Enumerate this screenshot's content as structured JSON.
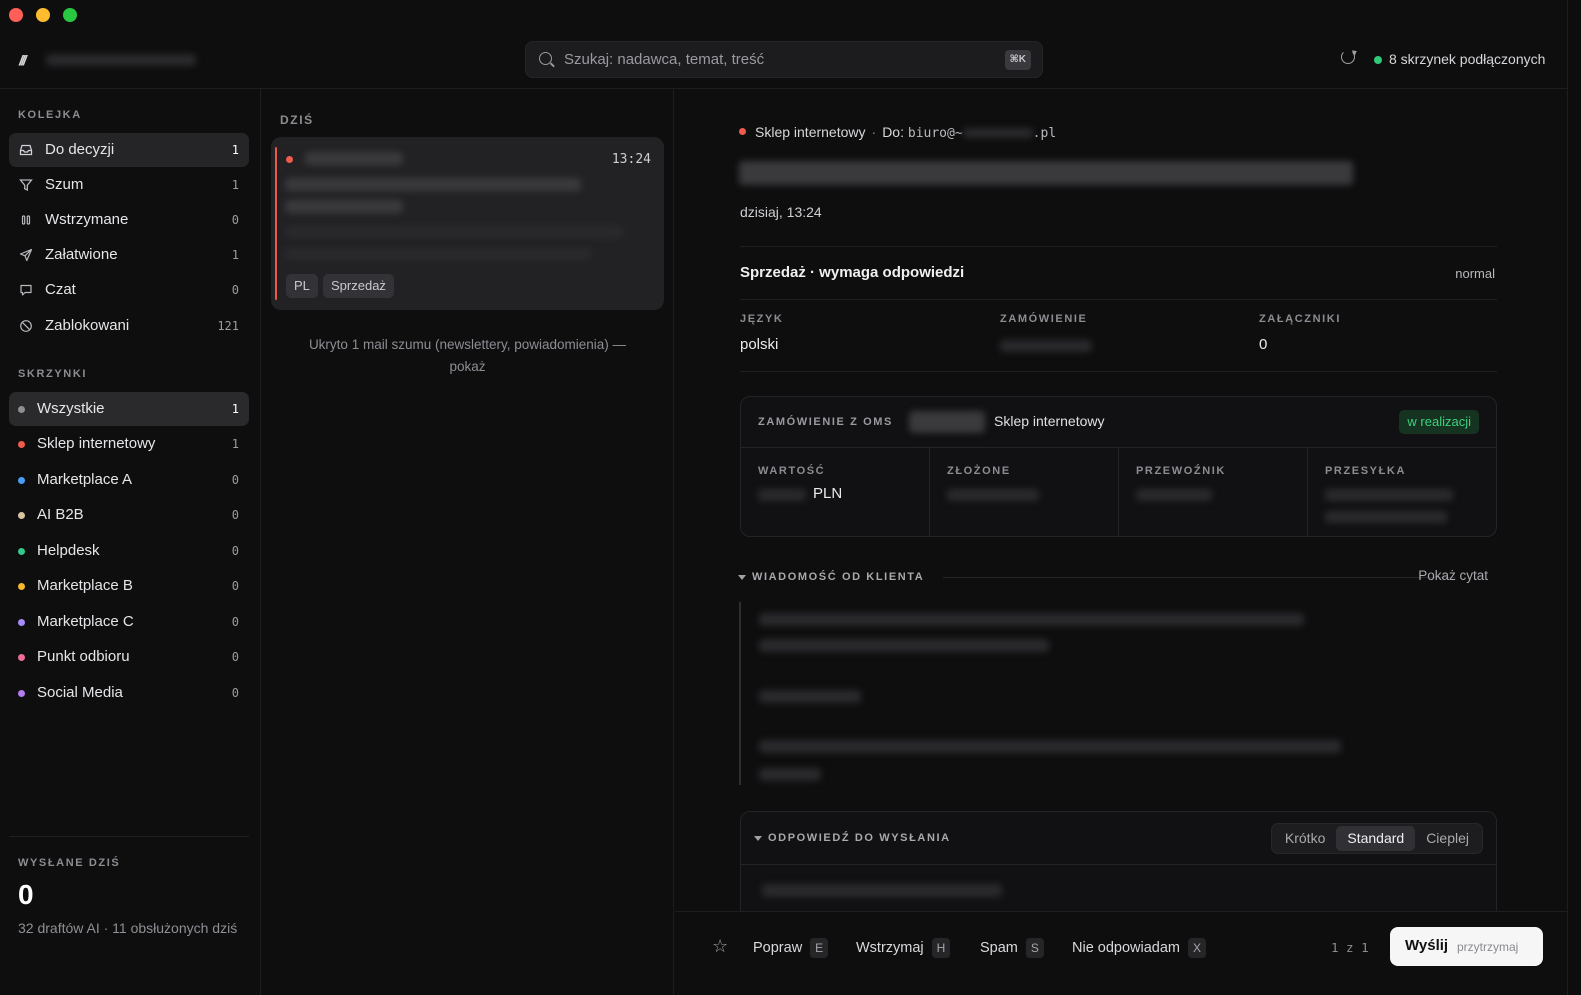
{
  "topbar": {
    "logo": "///",
    "search_placeholder": "Szukaj: nadawca, temat, treść",
    "search_shortcut": "⌘K",
    "status": "8 skrzynek podłączonych",
    "status_color": "#30c97a"
  },
  "sidebar": {
    "queue_label": "KOLEJKA",
    "queue": [
      {
        "label": "Do decyzji",
        "count": "1",
        "icon": "inbox-icon"
      },
      {
        "label": "Szum",
        "count": "1",
        "icon": "filter-icon"
      },
      {
        "label": "Wstrzymane",
        "count": "0",
        "icon": "pause-icon"
      },
      {
        "label": "Załatwione",
        "count": "1",
        "icon": "send-icon"
      },
      {
        "label": "Czat",
        "count": "0",
        "icon": "chat-icon"
      },
      {
        "label": "Zablokowani",
        "count": "121",
        "icon": "block-icon"
      }
    ],
    "boxes_label": "SKRZYNKI",
    "boxes": [
      {
        "label": "Wszystkie",
        "count": "1",
        "color": "#8e8e93"
      },
      {
        "label": "Sklep internetowy",
        "count": "1",
        "color": "#ef5c4b"
      },
      {
        "label": "Marketplace A",
        "count": "0",
        "color": "#4a9df5"
      },
      {
        "label": "AI B2B",
        "count": "0",
        "color": "#d6c3a0"
      },
      {
        "label": "Helpdesk",
        "count": "0",
        "color": "#34c98b"
      },
      {
        "label": "Marketplace B",
        "count": "0",
        "color": "#f5b731"
      },
      {
        "label": "Marketplace C",
        "count": "0",
        "color": "#a78bfa"
      },
      {
        "label": "Punkt odbioru",
        "count": "0",
        "color": "#f06c9b"
      },
      {
        "label": "Social Media",
        "count": "0",
        "color": "#b57cf2"
      }
    ],
    "sent_label": "WYSŁANE DZIŚ",
    "sent_count": "0",
    "sent_desc": "32 draftów AI · 11 obsłużonych dziś"
  },
  "list": {
    "section": "DZIŚ",
    "mail": {
      "time": "13:24",
      "tags": [
        "PL",
        "Sprzedaż"
      ]
    },
    "hidden_note": "Ukryto 1 mail szumu (newslettery, powiadomienia) — pokaż"
  },
  "detail": {
    "from": "Sklep internetowy",
    "to_label": "Do:",
    "to_prefix": "biuro@~",
    "to_suffix": ".pl",
    "date": "dzisiaj, 13:24",
    "category": "Sprzedaż · wymaga odpowiedzi",
    "priority": "normal",
    "meta": {
      "lang_label": "JĘZYK",
      "lang_value": "polski",
      "order_label": "ZAMÓWIENIE",
      "attach_label": "ZAŁĄCZNIKI",
      "attach_value": "0"
    },
    "oms": {
      "label": "ZAMÓWIENIE Z OMS",
      "shop": "Sklep internetowy",
      "status": "w realizacji",
      "value_label": "WARTOŚĆ",
      "currency": "PLN",
      "placed_label": "ZŁOŻONE",
      "carrier_label": "PRZEWOŹNIK",
      "shipment_label": "PRZESYŁKA"
    },
    "message_label": "WIADOMOŚĆ OD KLIENTA",
    "show_quote": "Pokaż cytat",
    "reply_label": "ODPOWIEDŹ DO WYSŁANIA",
    "tones": [
      "Krótko",
      "Standard",
      "Cieplej"
    ],
    "tone_active": "Standard"
  },
  "actions": {
    "fix": "Popraw",
    "fix_key": "E",
    "hold": "Wstrzymaj",
    "hold_key": "H",
    "spam": "Spam",
    "spam_key": "S",
    "noreply": "Nie odpowiadam",
    "noreply_key": "X",
    "pager": "1 z 1",
    "send": "Wyślij",
    "send_hint": "przytrzymaj"
  }
}
